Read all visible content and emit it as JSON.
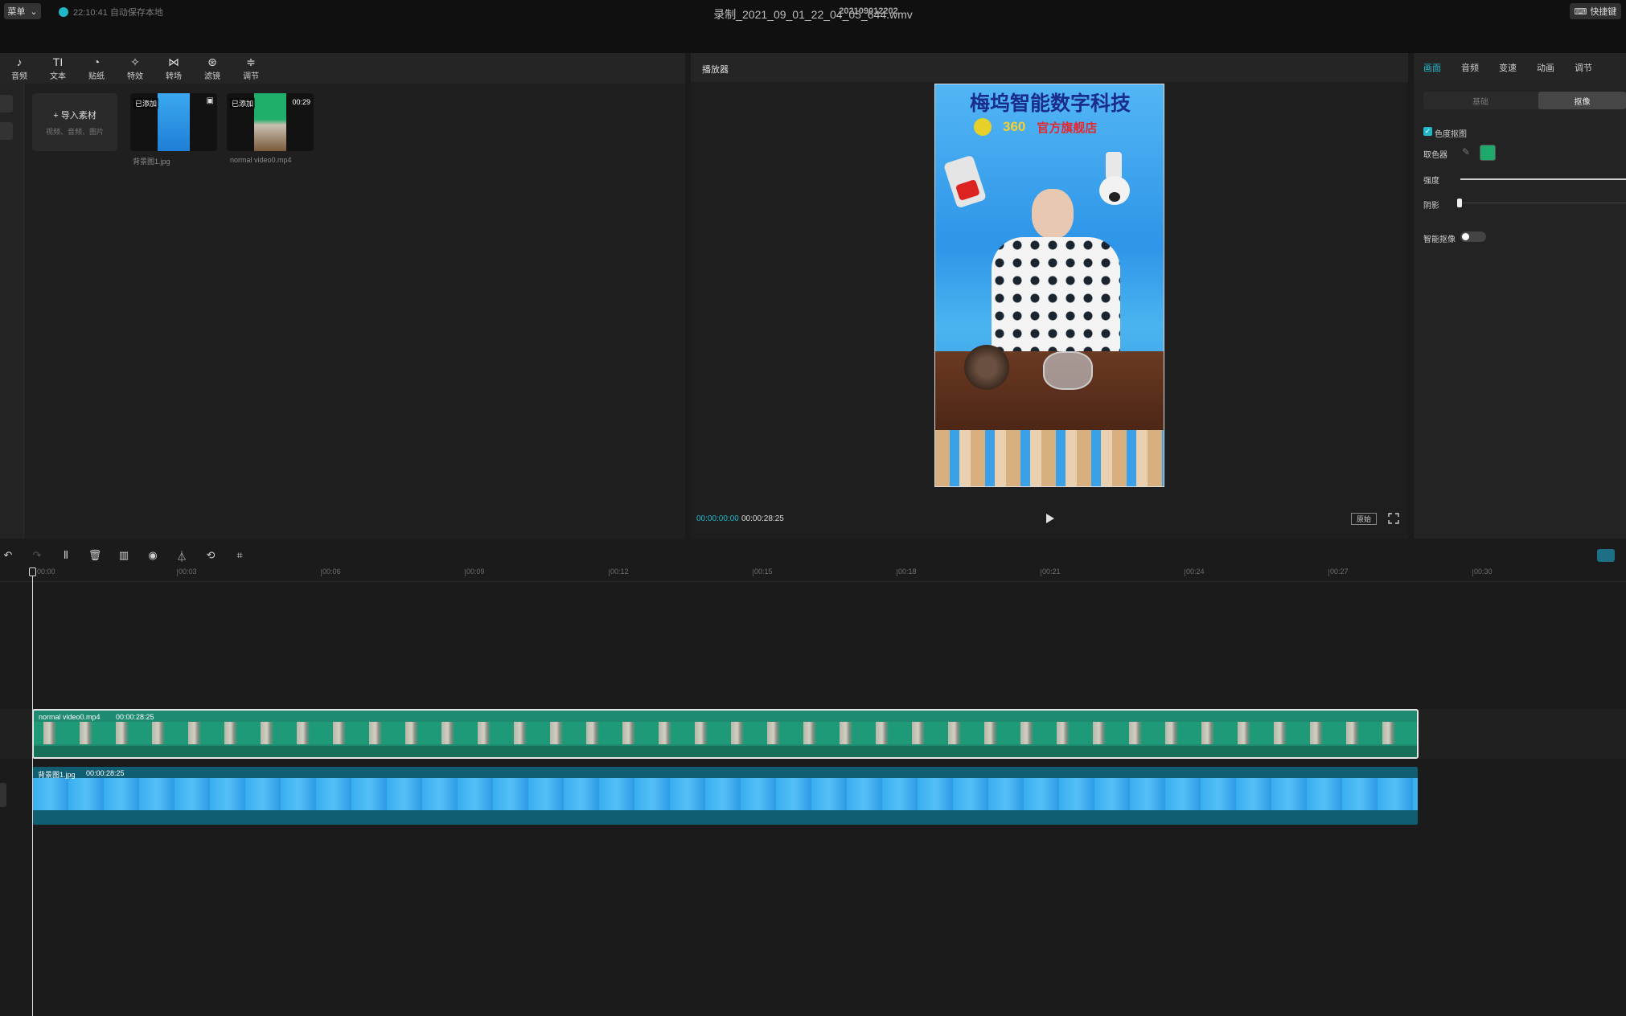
{
  "window": {
    "title": "录制_2021_09_01_22_04_05_644.wmv"
  },
  "menubar": {
    "menu_label": "菜单",
    "autosave_text": "22:10:41 自动保存本地",
    "project_name": "202109012202",
    "shortcut_label": "快捷键"
  },
  "toolbar": {
    "items": [
      {
        "label": "音频",
        "icon": "audio-icon",
        "glyph": "♪"
      },
      {
        "label": "文本",
        "icon": "text-icon",
        "glyph": "TI"
      },
      {
        "label": "贴纸",
        "icon": "sticker-icon",
        "glyph": "◔"
      },
      {
        "label": "特效",
        "icon": "effects-icon",
        "glyph": "✧"
      },
      {
        "label": "转场",
        "icon": "transition-icon",
        "glyph": "⋈"
      },
      {
        "label": "滤镜",
        "icon": "filter-icon",
        "glyph": "⊛"
      },
      {
        "label": "调节",
        "icon": "adjust-icon",
        "glyph": "≑"
      }
    ]
  },
  "media": {
    "import_label": "导入素材",
    "import_hint": "视频、音频、图片",
    "items": [
      {
        "tag": "已添加",
        "name": "背景图1.jpg",
        "duration": ""
      },
      {
        "tag": "已添加",
        "name": "normal video0.mp4",
        "duration": "00:29"
      }
    ]
  },
  "player": {
    "title": "播放器",
    "current_time": "00:00:00:00",
    "total_time": "00:00:28:25",
    "ratio_label": "原始",
    "overlay_title": "梅坞智能数字科技",
    "overlay_brand": "360",
    "overlay_store": "官方旗舰店"
  },
  "properties": {
    "tabs": [
      "画面",
      "音频",
      "变速",
      "动画",
      "调节"
    ],
    "active_tab": "画面",
    "subtabs": [
      "基础",
      "抠像"
    ],
    "chroma_label": "色度抠图",
    "picker_label": "取色器",
    "intensity_label": "强度",
    "shadow_label": "阴影",
    "smart_label": "智能抠像",
    "picked_color": "#1ea96a"
  },
  "timeline": {
    "ruler": [
      "00:00",
      "00:03",
      "00:06",
      "00:09",
      "00:12",
      "00:15",
      "00:18",
      "00:21",
      "00:24",
      "00:27",
      "00:30"
    ],
    "tracks": [
      {
        "name": "normal video0.mp4",
        "duration": "00:00:28:25"
      },
      {
        "name": "背景图1.jpg",
        "duration": "00:00:28:25"
      }
    ]
  },
  "colors": {
    "accent": "#20b8c8",
    "video_clip": "#1e8a6f",
    "image_clip": "#0f5e72"
  }
}
